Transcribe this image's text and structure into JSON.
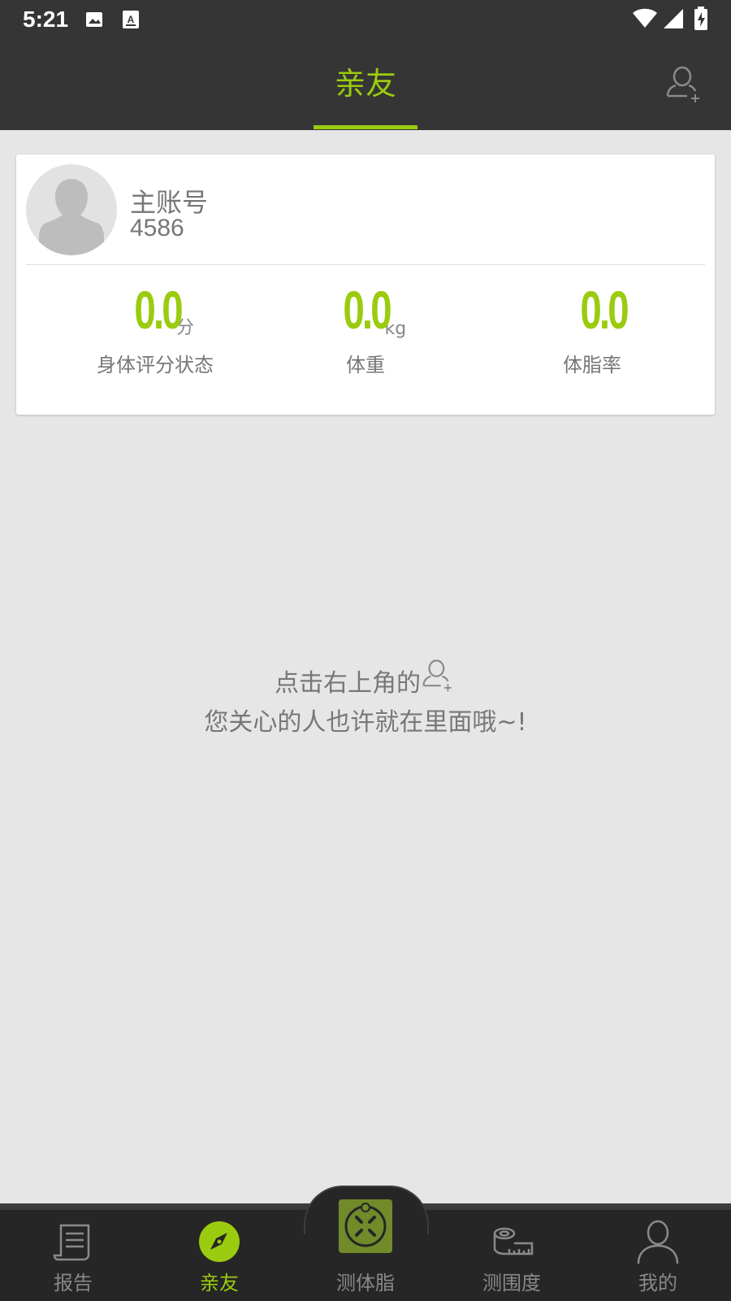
{
  "status_bar": {
    "time": "5:21",
    "left_icons": [
      "image-icon",
      "keyboard-icon"
    ],
    "right_icons": [
      "wifi-icon",
      "signal-icon",
      "battery-charging-icon"
    ]
  },
  "header": {
    "title": "亲友",
    "action_icon": "add-user-icon"
  },
  "account_card": {
    "name": "主账号",
    "id": "4586",
    "stats": [
      {
        "value": "0.0",
        "unit": "分",
        "label": "身体评分状态"
      },
      {
        "value": "0.0",
        "unit": "kg",
        "label": "体重"
      },
      {
        "value": "0.0",
        "unit": "",
        "label": "体脂率"
      }
    ]
  },
  "empty_state": {
    "line1": "点击右上角的",
    "line2": "您关心的人也许就在里面哦~!"
  },
  "tabbar": {
    "tabs": [
      {
        "label": "报告",
        "icon": "report-icon",
        "active": false
      },
      {
        "label": "亲友",
        "icon": "compass-icon",
        "active": true
      },
      {
        "label": "测体脂",
        "icon": "scale-icon",
        "active": false
      },
      {
        "label": "测围度",
        "icon": "tape-measure-icon",
        "active": false
      },
      {
        "label": "我的",
        "icon": "profile-icon",
        "active": false
      }
    ]
  },
  "colors": {
    "accent": "#9bcb0e",
    "header_bg": "#353535",
    "page_bg": "#e6e6e6",
    "tabbar_bg": "#262626"
  }
}
